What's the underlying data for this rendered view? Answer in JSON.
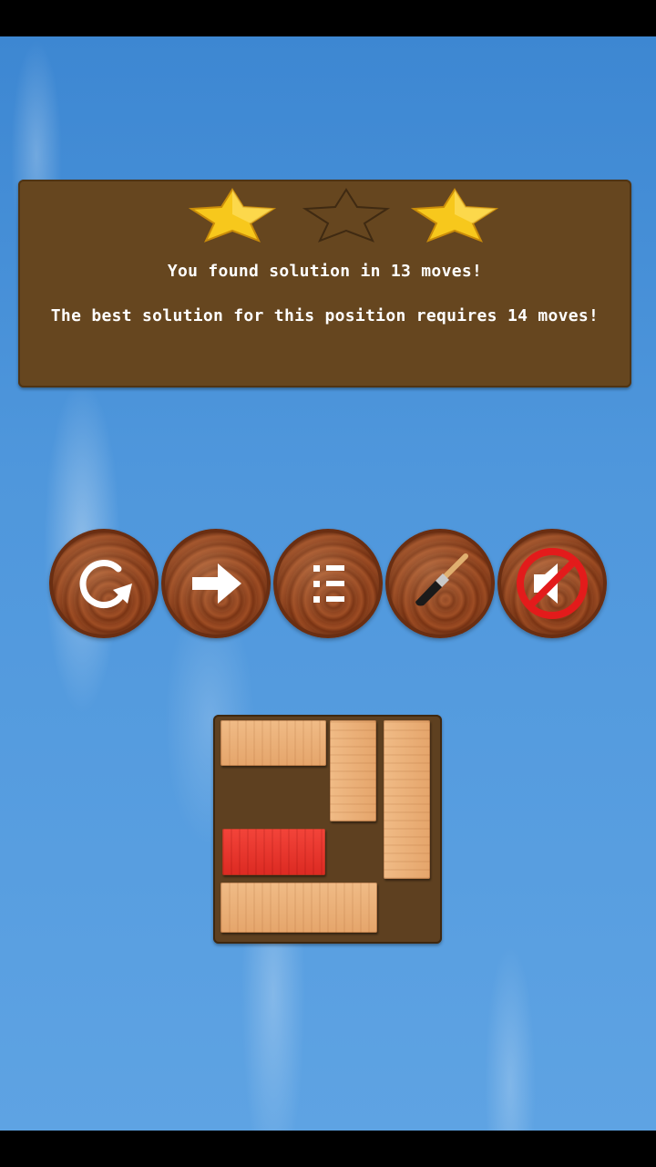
{
  "result": {
    "stars_earned": 2,
    "stars_total": 3,
    "stars": [
      true,
      false,
      true
    ],
    "message_found": "You found solution in 13 moves!",
    "message_best": "The best solution for this position requires 14 moves!"
  },
  "toolbar": {
    "buttons": [
      {
        "name": "restart-button",
        "icon": "restart-icon"
      },
      {
        "name": "next-button",
        "icon": "arrow-right-icon"
      },
      {
        "name": "level-list-button",
        "icon": "list-icon"
      },
      {
        "name": "theme-button",
        "icon": "paintbrush-icon"
      },
      {
        "name": "sound-toggle-button",
        "icon": "sound-muted-icon",
        "state": "muted"
      }
    ]
  },
  "board": {
    "grid_size": 4,
    "exit_row": 3,
    "blocks": [
      {
        "name": "block-horizontal-top",
        "orientation": "horizontal",
        "row": 1,
        "col": 1,
        "length": 2
      },
      {
        "name": "block-vertical-middle",
        "orientation": "vertical",
        "row": 1,
        "col": 3,
        "length": 2
      },
      {
        "name": "block-vertical-right",
        "orientation": "vertical",
        "row": 1,
        "col": 4,
        "length": 3
      },
      {
        "name": "block-red-target",
        "orientation": "horizontal",
        "row": 3,
        "col": 1,
        "length": 2,
        "target": true
      },
      {
        "name": "block-horizontal-bottom",
        "orientation": "horizontal",
        "row": 4,
        "col": 1,
        "length": 3
      }
    ]
  },
  "colors": {
    "panel": "#66461f",
    "star_gold": "#f7c81c",
    "target_block": "#e8312a",
    "wood_block": "#e9ab72",
    "sky": "#4f97dc"
  }
}
